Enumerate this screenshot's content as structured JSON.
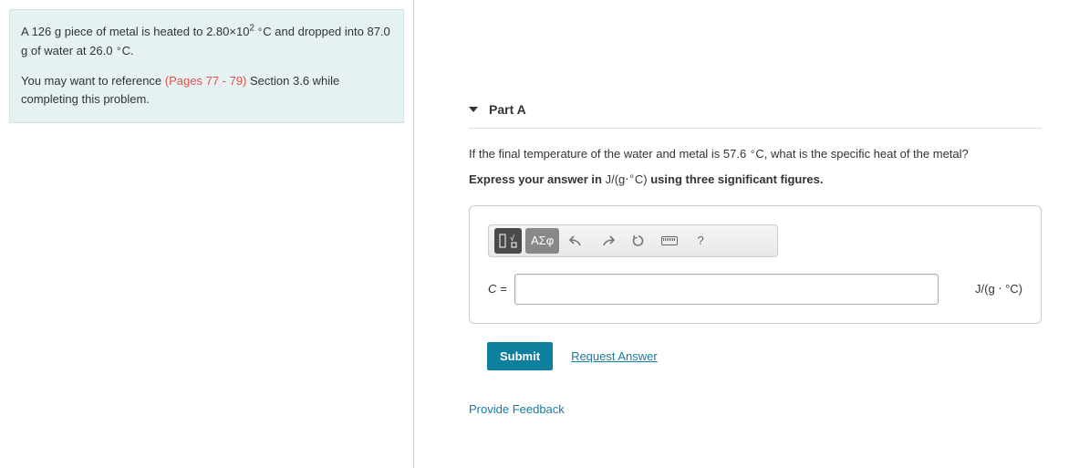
{
  "problem": {
    "paragraph1_pre": "A 126 g piece of metal is heated to 2.80×10",
    "paragraph1_sup": "2",
    "paragraph1_deg": " ∘",
    "paragraph1_post": "C and dropped into 87.0 g of water at 26.0 ",
    "paragraph1_deg2": "∘",
    "paragraph1_end": "C.",
    "paragraph2_pre": "You may want to reference ",
    "reference_link": "(Pages 77 - 79)",
    "paragraph2_post": " Section 3.6 while completing this problem."
  },
  "part": {
    "title": "Part A",
    "question_pre": "If the final temperature of the water and metal is 57.6 ",
    "question_deg": "∘",
    "question_post": "C, what is the specific heat of the metal?",
    "instruction_pre": "Express your answer in ",
    "instruction_unit": "J/(g⋅",
    "instruction_deg": "∘",
    "instruction_unit2": "C)",
    "instruction_post": " using three significant figures."
  },
  "toolbar": {
    "greek_label": "ΑΣφ",
    "help_label": "?"
  },
  "input": {
    "var_label": "C =",
    "unit_label": "J/(g ⋅ °C)"
  },
  "buttons": {
    "submit": "Submit",
    "request": "Request Answer",
    "feedback": "Provide Feedback"
  }
}
